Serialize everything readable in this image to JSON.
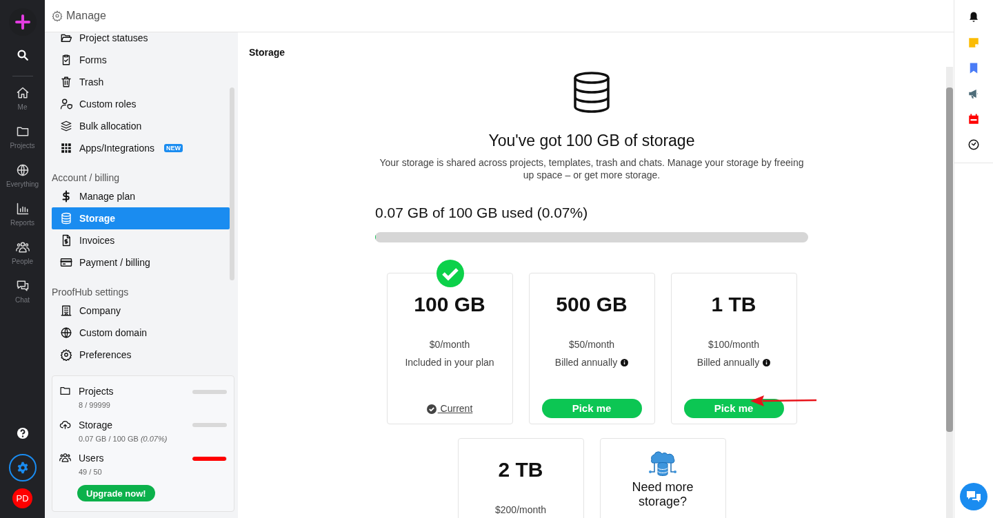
{
  "header": {
    "title": "Manage"
  },
  "rail": {
    "items": [
      {
        "label": "Me"
      },
      {
        "label": "Projects"
      },
      {
        "label": "Everything"
      },
      {
        "label": "Reports"
      },
      {
        "label": "People"
      },
      {
        "label": "Chat"
      }
    ],
    "avatar": "PD",
    "settings_selected": true
  },
  "sidebar": {
    "sections": [
      {
        "items": [
          {
            "label": "Project statuses",
            "selected": false
          },
          {
            "label": "Forms",
            "selected": false
          },
          {
            "label": "Trash",
            "selected": false
          },
          {
            "label": "Custom roles",
            "selected": false
          },
          {
            "label": "Bulk allocation",
            "selected": false
          },
          {
            "label": "Apps/Integrations",
            "badge": "NEW",
            "selected": false
          }
        ]
      },
      {
        "heading": "Account / billing",
        "items": [
          {
            "label": "Manage plan",
            "selected": false
          },
          {
            "label": "Storage",
            "selected": true
          },
          {
            "label": "Invoices",
            "selected": false
          },
          {
            "label": "Payment / billing",
            "selected": false
          }
        ]
      },
      {
        "heading": "ProofHub settings",
        "items": [
          {
            "label": "Company",
            "selected": false
          },
          {
            "label": "Custom domain",
            "selected": false
          },
          {
            "label": "Preferences",
            "selected": false
          }
        ]
      }
    ],
    "usage": [
      {
        "name": "Projects",
        "detail": "8 / 99999",
        "level": 0.0001
      },
      {
        "name": "Storage",
        "detail": "0.07 GB / 100 GB *(0.07%)*",
        "level": 0.0007
      },
      {
        "name": "Users",
        "detail": "49 / 50",
        "level": 0.98
      }
    ],
    "upgrade_button": "Upgrade now!"
  },
  "main": {
    "title": "Storage",
    "heading": "You've got 100 GB of storage",
    "description": "Your storage is shared across projects, templates, trash and chats. Manage your storage by freeing up space – or get more storage.",
    "usage_label": "0.07 GB of 100 GB used (0.07%)",
    "usage_bar": {
      "level": 0.0007
    },
    "plans": [
      {
        "kind": "plan",
        "size": "100 GB",
        "price": "$0/month",
        "note": "Included in your plan",
        "info": false,
        "selected": true,
        "action": "Current"
      },
      {
        "kind": "plan",
        "size": "500 GB",
        "price": "$50/month",
        "note": "Billed annually",
        "info": true,
        "selected": false,
        "action": "Pick me"
      },
      {
        "kind": "plan",
        "size": "1 TB",
        "price": "$100/month",
        "note": "Billed annually",
        "info": true,
        "selected": false,
        "action": "Pick me"
      },
      {
        "kind": "plan",
        "size": "2 TB",
        "price": "$200/month",
        "selected": false
      },
      {
        "kind": "custom",
        "title": "Need more storage?"
      }
    ]
  }
}
